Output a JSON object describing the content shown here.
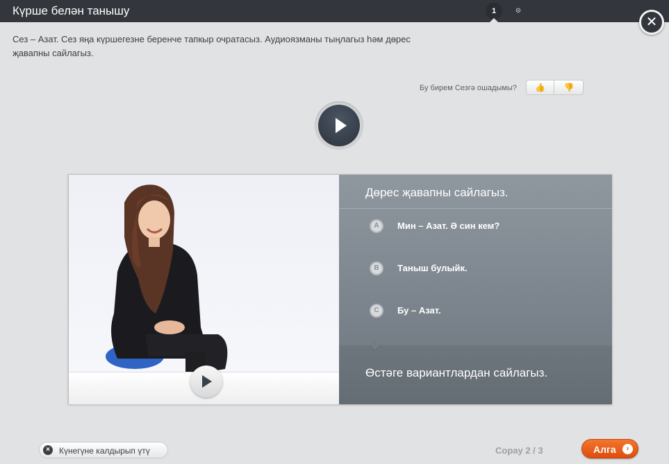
{
  "header": {
    "title": "Күрше белән танышу",
    "steps": [
      {
        "label": "1",
        "state": "active"
      },
      {
        "label": "⊙",
        "state": "next"
      }
    ]
  },
  "close_icon": "close-icon",
  "instruction": "Сез – Азат. Сез яңа күршегезне беренче тапкыр очратасыз. Аудиоязманы тыңлагыз һәм дөрес җавапны сайлагыз.",
  "feedback": {
    "label": "Бу бирем Сезгә ошадымы?",
    "up_icon": "👍",
    "down_icon": "👎"
  },
  "quiz": {
    "title": "Дөрес җавапны сайлагыз.",
    "options": [
      {
        "letter": "A",
        "text": "Мин – Азат. Ә син кем?"
      },
      {
        "letter": "B",
        "text": "Таныш булыйк."
      },
      {
        "letter": "C",
        "text": "Бу – Азат."
      }
    ],
    "hint": "Өстәге вариантлардан сайлагыз."
  },
  "footer": {
    "skip_label": "Күнегүне калдырып үтү",
    "skip_icon": "×",
    "counter": "Сорау 2 / 3",
    "next_label": "Алга",
    "next_icon": "›"
  },
  "colors": {
    "header_bg": "#33373d",
    "page_bg": "#e1e2e3",
    "accent_orange": "#ef6a22",
    "panel_bg": "#7f878f"
  }
}
